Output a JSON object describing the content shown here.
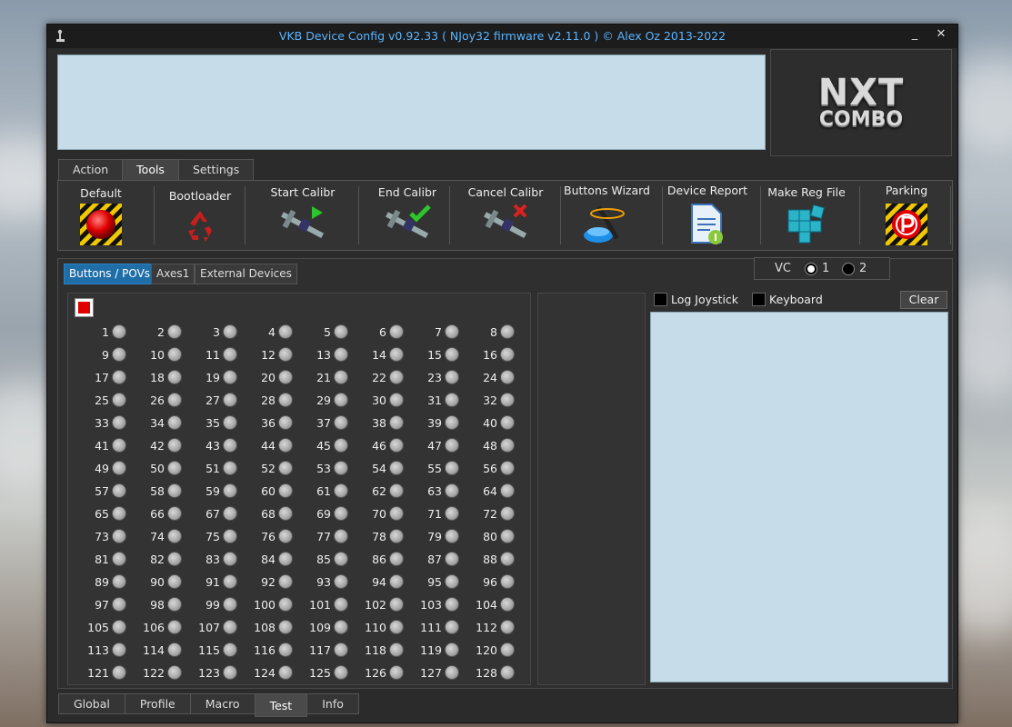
{
  "window": {
    "title": "VKB Device Config v0.92.33 ( NJoy32 firmware v2.11.0 ) © Alex Oz 2013-2022",
    "minimize_label": "_",
    "close_label": "✕"
  },
  "logo": {
    "line1": "NXT",
    "line2": "COMBO"
  },
  "top_tabs": [
    {
      "label": "Action",
      "active": false
    },
    {
      "label": "Tools",
      "active": true
    },
    {
      "label": "Settings",
      "active": false
    }
  ],
  "tools": [
    {
      "label": "Default",
      "icon": "red-button-icon"
    },
    {
      "label": "Bootloader",
      "icon": "recycle-icon"
    },
    {
      "label": "Start Calibr",
      "icon": "caliper-play-icon"
    },
    {
      "label": "End Calibr",
      "icon": "caliper-check-icon"
    },
    {
      "label": "Cancel Calibr",
      "icon": "caliper-cancel-icon"
    },
    {
      "label": "Buttons Wizard",
      "icon": "wizard-wand-icon"
    },
    {
      "label": "Device Report",
      "icon": "document-info-icon"
    },
    {
      "label": "Make Reg File",
      "icon": "registry-cubes-icon"
    },
    {
      "label": "Parking",
      "icon": "parking-icon"
    }
  ],
  "sub_tabs": [
    {
      "label": "Buttons / POVs",
      "active": true
    },
    {
      "label": "Axes1",
      "active": false
    },
    {
      "label": "External Devices",
      "active": false
    }
  ],
  "vc": {
    "label": "VC",
    "option1": "1",
    "option2": "2",
    "selected": "1"
  },
  "log": {
    "log_joystick_label": "Log Joystick",
    "keyboard_label": "Keyboard",
    "clear_label": "Clear"
  },
  "buttons": {
    "count": 128,
    "labels": [
      "1",
      "2",
      "3",
      "4",
      "5",
      "6",
      "7",
      "8",
      "9",
      "10",
      "11",
      "12",
      "13",
      "14",
      "15",
      "16",
      "17",
      "18",
      "19",
      "20",
      "21",
      "22",
      "23",
      "24",
      "25",
      "26",
      "27",
      "28",
      "29",
      "30",
      "31",
      "32",
      "33",
      "34",
      "35",
      "36",
      "37",
      "38",
      "39",
      "40",
      "41",
      "42",
      "43",
      "44",
      "45",
      "46",
      "47",
      "48",
      "49",
      "50",
      "51",
      "52",
      "53",
      "54",
      "55",
      "56",
      "57",
      "58",
      "59",
      "60",
      "61",
      "62",
      "63",
      "64",
      "65",
      "66",
      "67",
      "68",
      "69",
      "70",
      "71",
      "72",
      "73",
      "74",
      "75",
      "76",
      "77",
      "78",
      "79",
      "80",
      "81",
      "82",
      "83",
      "84",
      "85",
      "86",
      "87",
      "88",
      "89",
      "90",
      "91",
      "92",
      "93",
      "94",
      "95",
      "96",
      "97",
      "98",
      "99",
      "100",
      "101",
      "102",
      "103",
      "104",
      "105",
      "106",
      "107",
      "108",
      "109",
      "110",
      "111",
      "112",
      "113",
      "114",
      "115",
      "116",
      "117",
      "118",
      "119",
      "120",
      "121",
      "122",
      "123",
      "124",
      "125",
      "126",
      "127",
      "128"
    ]
  },
  "bottom_tabs": [
    {
      "label": "Global",
      "active": false
    },
    {
      "label": "Profile",
      "active": false
    },
    {
      "label": "Macro",
      "active": false
    },
    {
      "label": "Test",
      "active": true
    },
    {
      "label": "Info",
      "active": false
    }
  ]
}
